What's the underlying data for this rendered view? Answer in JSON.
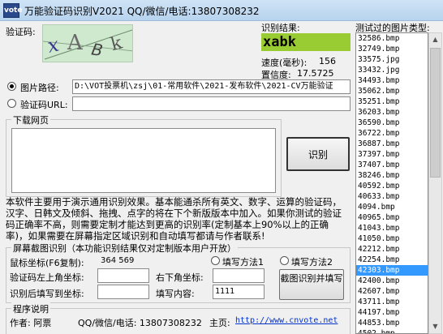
{
  "window": {
    "title": "万能验证码识别V2021   QQ/微信/电话:13807308232",
    "icon_text": "vote"
  },
  "captcha": {
    "label": "验证码:",
    "image_text": "xabk",
    "result_label": "识别结果:",
    "result_value": "xabk",
    "speed_label": "速度(毫秒):",
    "speed_value": "156",
    "confidence_label": "置信度:",
    "confidence_value": "17.5725"
  },
  "source": {
    "image_path_label": "图片路径:",
    "image_path_value": "D:\\VOT投票机\\zsj\\01-常用软件\\2021-发布软件\\2021-CV万能验证",
    "url_label": "验证码URL:",
    "url_value": "",
    "selected": "image_path"
  },
  "download_group": {
    "title": "下载网页",
    "content": ""
  },
  "recognize_button": "识别",
  "description": "本软件主要用于演示通用识别效果。基本能通杀所有英文、数字、运算的验证码，汉字、日韩文及倾斜、拖拽、点字的将在下个新版版本中加入。如果你测试的验证码正确率不高，则需要定制才能达到更高的识别率(定制基本上90%以上的正确率)，如果需要在屏幕指定区域识别和自动填写都请与作者联系!",
  "screen_group": {
    "title": "屏幕截图识别（本功能识别结果仅对定制版本用户开放）",
    "mouse_coord_label": "鼠标坐标(F6复制):",
    "mouse_coord_value": "364 569",
    "method1_label": "填写方法1",
    "method2_label": "填写方法2",
    "top_left_label": "验证码左上角坐标:",
    "top_left_value": "",
    "bottom_right_label": "右下角坐标:",
    "bottom_right_value": "",
    "fill_coord_label": "识别后填写到坐标:",
    "fill_coord_value": "",
    "fill_content_label": "填写内容:",
    "fill_content_value": "1111",
    "capture_button": "截图识别并填写"
  },
  "about_group": {
    "title": "程序说明",
    "author_label": "作者: 阿票",
    "contact": "QQ/微信/电话: 13807308232",
    "homepage_label": "主页:",
    "homepage_url": "http://www.cnvote.net"
  },
  "image_list": {
    "title": "测试过的图片类型:",
    "selected_index": 22,
    "items": [
      "32586.bmp",
      "32749.bmp",
      "33575.jpg",
      "33432.jpg",
      "34493.bmp",
      "35062.bmp",
      "35251.bmp",
      "36203.bmp",
      "36590.bmp",
      "36722.bmp",
      "36887.bmp",
      "37397.bmp",
      "37407.bmp",
      "38246.bmp",
      "40592.bmp",
      "40633.bmp",
      "4094.bmp",
      "40965.bmp",
      "41043.bmp",
      "41050.bmp",
      "42212.bmp",
      "42254.bmp",
      "42303.bmp",
      "42400.bmp",
      "42607.bmp",
      "43711.bmp",
      "44197.bmp",
      "44853.bmp",
      "4502.bmp",
      "45132.bmp"
    ]
  }
}
